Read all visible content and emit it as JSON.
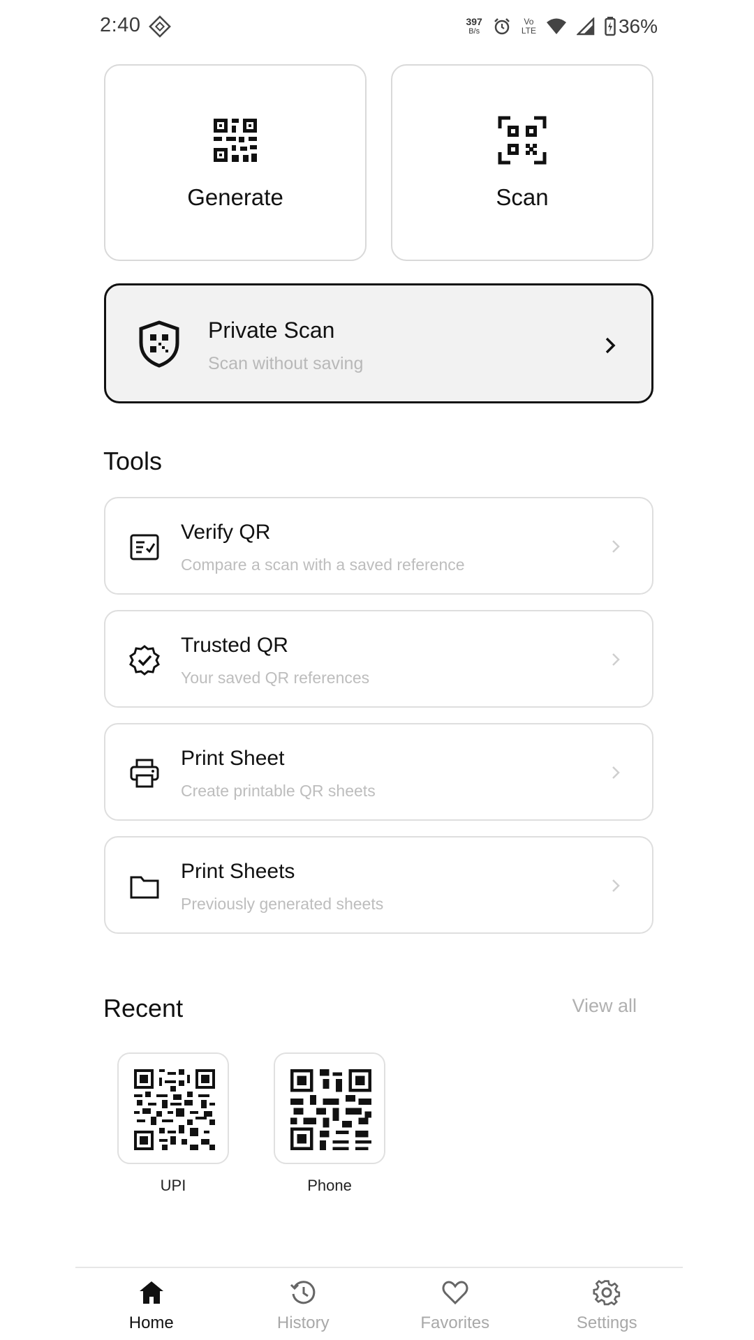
{
  "status_bar": {
    "time": "2:40",
    "net_speed_value": "397",
    "net_speed_unit": "B/s",
    "volte_top": "Vo",
    "volte_bottom": "LTE",
    "battery": "36%"
  },
  "actions": {
    "generate_label": "Generate",
    "scan_label": "Scan"
  },
  "private_scan": {
    "title": "Private Scan",
    "subtitle": "Scan without saving"
  },
  "tools": {
    "section_title": "Tools",
    "items": [
      {
        "title": "Verify QR",
        "subtitle": "Compare a scan with a saved reference",
        "icon": "verify-list-icon"
      },
      {
        "title": "Trusted QR",
        "subtitle": "Your saved QR references",
        "icon": "verified-badge-icon"
      },
      {
        "title": "Print Sheet",
        "subtitle": "Create printable QR sheets",
        "icon": "printer-icon"
      },
      {
        "title": "Print Sheets",
        "subtitle": "Previously generated sheets",
        "icon": "folder-icon"
      }
    ]
  },
  "recent": {
    "section_title": "Recent",
    "view_all": "View all",
    "items": [
      {
        "label": "UPI"
      },
      {
        "label": "Phone"
      }
    ]
  },
  "nav": {
    "items": [
      {
        "label": "Home",
        "icon": "home-icon",
        "active": true
      },
      {
        "label": "History",
        "icon": "history-icon",
        "active": false
      },
      {
        "label": "Favorites",
        "icon": "heart-icon",
        "active": false
      },
      {
        "label": "Settings",
        "icon": "gear-icon",
        "active": false
      }
    ]
  },
  "colors": {
    "accent": "#111111",
    "card_border": "#d9d9d9",
    "private_bg": "#f2f2f2",
    "muted_text": "#b8b8b8"
  }
}
